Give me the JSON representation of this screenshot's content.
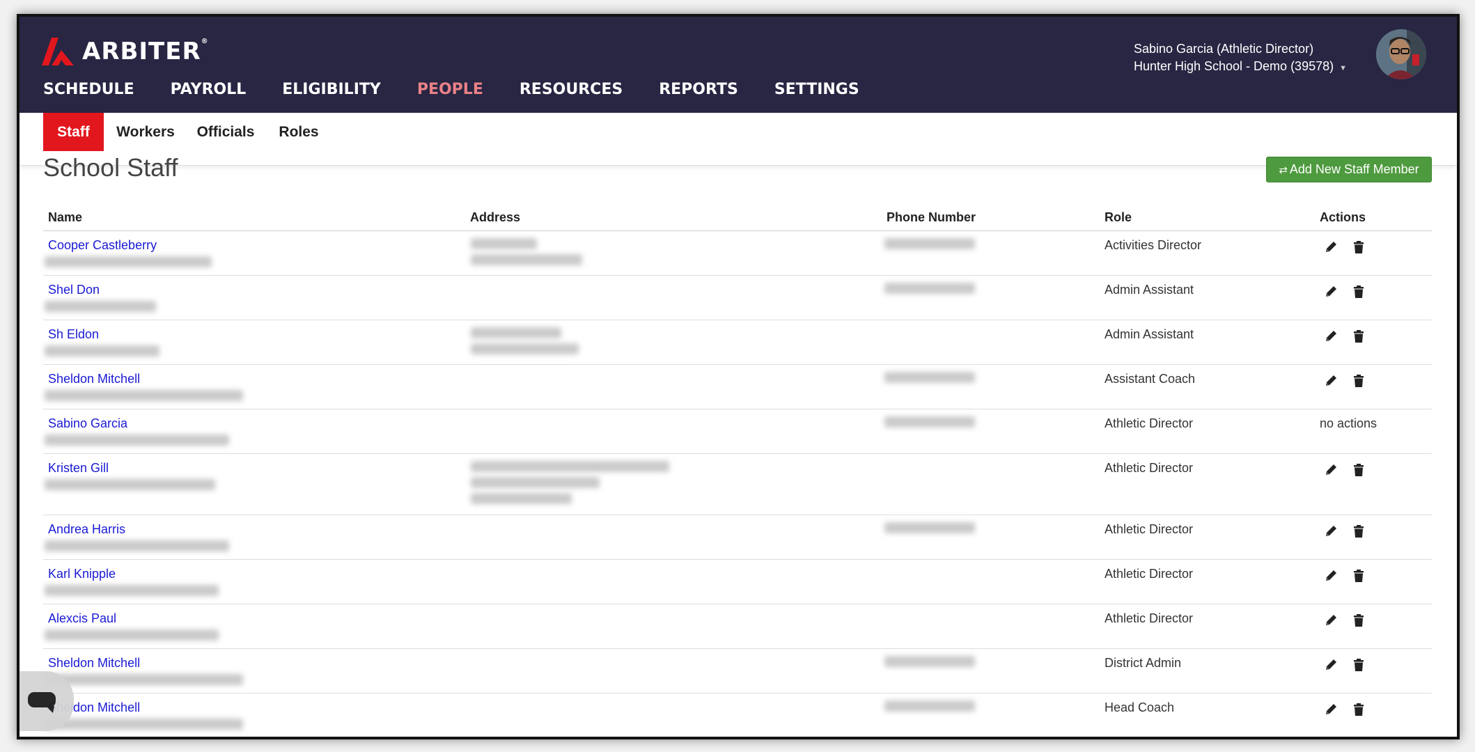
{
  "app": {
    "brand": "ARBITER",
    "brand_mark": "®"
  },
  "colors": {
    "header_bg": "#282643",
    "active_nav": "#e98187",
    "accent_red": "#e2161d",
    "add_button": "#4e9a3e",
    "link": "#1a1ad4"
  },
  "nav": {
    "items": [
      {
        "label": "SCHEDULE"
      },
      {
        "label": "PAYROLL"
      },
      {
        "label": "ELIGIBILITY"
      },
      {
        "label": "PEOPLE",
        "active": true
      },
      {
        "label": "RESOURCES"
      },
      {
        "label": "REPORTS"
      },
      {
        "label": "SETTINGS"
      }
    ]
  },
  "user": {
    "name": "Sabino Garcia (Athletic Director)",
    "school": "Hunter High School - Demo (39578)"
  },
  "subnav": {
    "tabs": [
      {
        "label": "Staff",
        "active": true
      },
      {
        "label": "Workers"
      },
      {
        "label": "Officials"
      },
      {
        "label": "Roles"
      }
    ]
  },
  "page": {
    "title": "School Staff",
    "add_button_label": "Add New Staff Member",
    "add_button_icon": "retweet-icon"
  },
  "table": {
    "headers": {
      "name": "Name",
      "address": "Address",
      "phone": "Phone Number",
      "role": "Role",
      "actions": "Actions"
    },
    "rows": [
      {
        "name": "Cooper Castleberry",
        "role": "Activities Director",
        "has_actions": true
      },
      {
        "name": "Shel Don",
        "role": "Admin Assistant",
        "has_actions": true
      },
      {
        "name": "Sh Eldon",
        "role": "Admin Assistant",
        "has_actions": true
      },
      {
        "name": "Sheldon Mitchell",
        "role": "Assistant Coach",
        "has_actions": true
      },
      {
        "name": "Sabino Garcia",
        "role": "Athletic Director",
        "has_actions": false,
        "actions_text": "no actions"
      },
      {
        "name": "Kristen Gill",
        "role": "Athletic Director",
        "has_actions": true
      },
      {
        "name": "Andrea Harris",
        "role": "Athletic Director",
        "has_actions": true
      },
      {
        "name": "Karl Knipple",
        "role": "Athletic Director",
        "has_actions": true
      },
      {
        "name": "Alexcis Paul",
        "role": "Athletic Director",
        "has_actions": true
      },
      {
        "name": "Sheldon Mitchell",
        "role": "District Admin",
        "has_actions": true
      },
      {
        "name": "Sheldon Mitchell",
        "role": "Head Coach",
        "has_actions": true
      }
    ]
  }
}
